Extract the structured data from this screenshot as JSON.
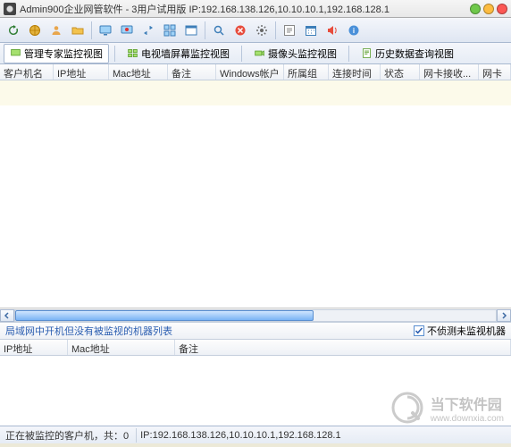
{
  "window": {
    "title": "Admin900企业网管软件 - 3用户试用版 IP:192.168.138.126,10.10.10.1,192.168.128.1"
  },
  "tabs": {
    "t0": "管理专家监控视图",
    "t1": "电视墙屏幕监控视图",
    "t2": "摄像头监控视图",
    "t3": "历史数据查询视图"
  },
  "columns_top": {
    "c0": "客户机名",
    "c1": "IP地址",
    "c2": "Mac地址",
    "c3": "备注",
    "c4": "Windows帐户",
    "c5": "所属组",
    "c6": "连接时间",
    "c7": "状态",
    "c8": "网卡接收...",
    "c9": "网卡"
  },
  "bottom": {
    "title": "局域网中开机但没有被监视的机器列表",
    "checkbox_label": "不侦测未监视机器",
    "checkbox_checked": true
  },
  "columns_bottom": {
    "c0": "IP地址",
    "c1": "Mac地址",
    "c2": "备注"
  },
  "status": {
    "text": "正在被监控的客户机，共：0",
    "ips": "IP:192.168.138.126,10.10.10.1,192.168.128.1"
  },
  "watermark": {
    "name_cn": "当下软件园",
    "url": "www.downxia.com"
  }
}
